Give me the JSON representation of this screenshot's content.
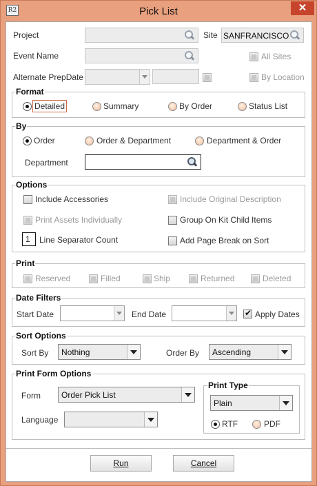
{
  "window": {
    "title": "Pick List",
    "app_icon": "R2",
    "close_glyph": "✕"
  },
  "top": {
    "project_label": "Project",
    "site_label": "Site",
    "site_value": "SANFRANCISCO",
    "event_label": "Event Name",
    "all_sites": "All Sites",
    "prep_label": "Alternate PrepDate",
    "by_location": "By Location"
  },
  "format": {
    "title": "Format",
    "options": [
      "Detailed",
      "Summary",
      "By Order",
      "Status List"
    ],
    "selected": "Detailed"
  },
  "by": {
    "title": "By",
    "options": [
      "Order",
      "Order & Department",
      "Department & Order"
    ],
    "selected": "Order",
    "department_label": "Department"
  },
  "options": {
    "title": "Options",
    "include_accessories": "Include Accessories",
    "include_original_description": "Include Original Description",
    "print_assets_individually": "Print Assets Individually",
    "group_on_kit_child_items": "Group On Kit Child Items",
    "line_separator_value": "1",
    "line_separator_label": "Line Separator Count",
    "add_page_break": "Add Page Break on Sort"
  },
  "print": {
    "title": "Print",
    "items": [
      "Reserved",
      "Filled",
      "Ship",
      "Returned",
      "Deleted"
    ]
  },
  "date_filters": {
    "title": "Date Filters",
    "start_label": "Start Date",
    "end_label": "End Date",
    "apply_dates": "Apply Dates",
    "apply_checked": true
  },
  "sort": {
    "title": "Sort Options",
    "sort_by_label": "Sort By",
    "sort_by_value": "Nothing",
    "order_by_label": "Order By",
    "order_by_value": "Ascending"
  },
  "print_form": {
    "title": "Print Form Options",
    "form_label": "Form",
    "form_value": "Order Pick List",
    "language_label": "Language",
    "print_type_title": "Print Type",
    "print_type_value": "Plain",
    "output_options": [
      "RTF",
      "PDF"
    ],
    "output_selected": "RTF"
  },
  "footer": {
    "run": "Run",
    "cancel": "Cancel"
  }
}
